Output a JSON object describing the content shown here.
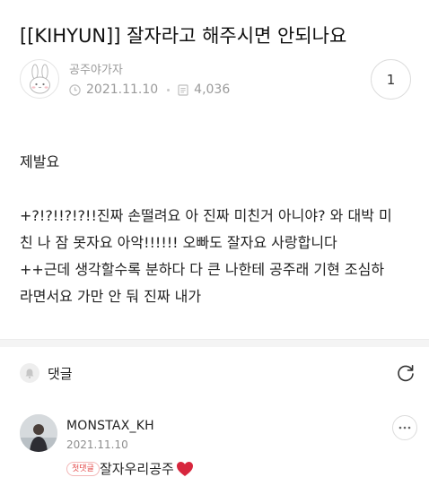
{
  "post": {
    "title": "[[KIHYUN]] 잘자라고 해주시면 안되나요",
    "author": "공주야가자",
    "date": "2021.11.10",
    "views": "4,036",
    "comment_count": "1",
    "body_lines": [
      "제발요",
      "",
      "+?!?!!?!?!!진짜 손떨려요 아 진짜 미친거 아니야? 와 대박 미",
      "친 나 잠 못자요 아악!!!!!! 오빠도 잘자요 사랑합니다",
      "++근데 생각할수록 분하다 다 큰 나한테 공주래 기현 조심하",
      "라면서요 가만 안 둬 진짜 내가"
    ]
  },
  "comments": {
    "header_label": "댓글",
    "items": [
      {
        "author": "MONSTAX_KH",
        "date": "2021.11.10",
        "badge": "첫댓글",
        "text": "잘자우리공주",
        "emoji_icon": "red-heart-icon"
      }
    ]
  },
  "colors": {
    "meta_gray": "#9a9a9a",
    "badge_red": "#e34a4a",
    "heart_red": "#d7263d",
    "divider_bg": "#f4f4f4"
  }
}
